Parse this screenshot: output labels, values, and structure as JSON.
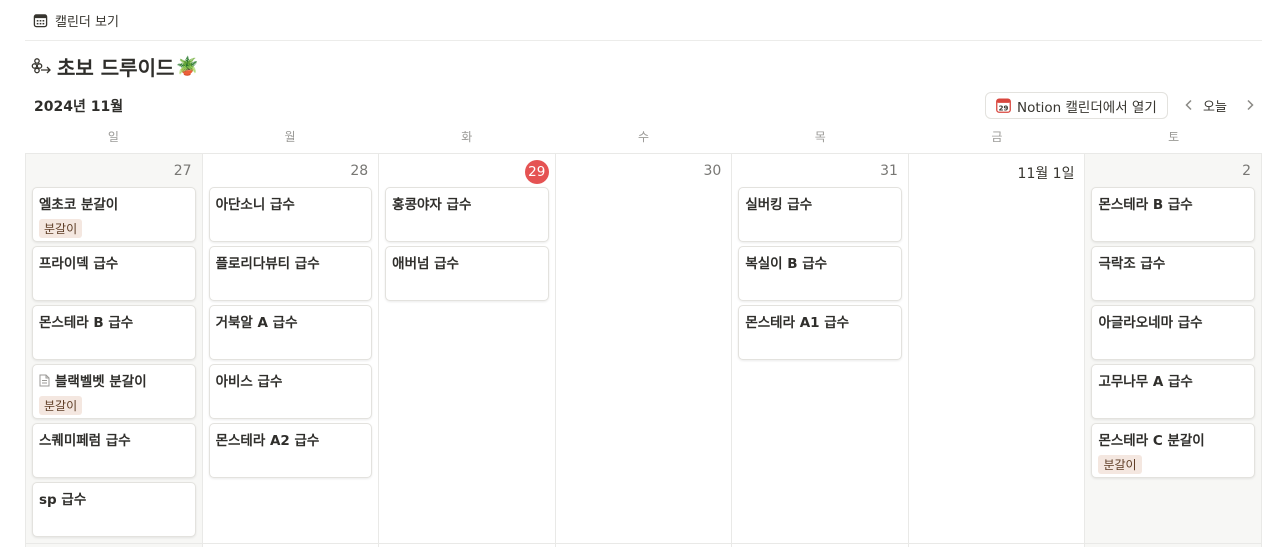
{
  "view": {
    "label": "캘린더 보기",
    "icon": "calendar-icon"
  },
  "page": {
    "title": "초보 드루이드",
    "title_icon": "plant-network-icon",
    "title_emoji": "🪴"
  },
  "month_label": "2024년 11월",
  "toolbar": {
    "open_notion_label": "Notion 캘린더에서 열기",
    "open_notion_icon_day": "29",
    "today_label": "오늘",
    "prev_icon": "chevron-left-icon",
    "next_icon": "chevron-right-icon"
  },
  "weekdays": [
    "일",
    "월",
    "화",
    "수",
    "목",
    "금",
    "토"
  ],
  "tag_color": "#f4e7e0",
  "today_color": "#e55353",
  "days": [
    {
      "date": "27",
      "cards": [
        {
          "title": "엘초코 분갈이",
          "tag": "분갈이"
        },
        {
          "title": "프라이덱 급수"
        },
        {
          "title": "몬스테라 B 급수"
        },
        {
          "title": "블랙벨벳 분갈이",
          "tag": "분갈이",
          "doc_icon": true
        },
        {
          "title": "스퀘미페럼 급수"
        },
        {
          "title": "sp 급수"
        }
      ]
    },
    {
      "date": "28",
      "cards": [
        {
          "title": "아단소니 급수"
        },
        {
          "title": "플로리다뷰티 급수"
        },
        {
          "title": "거북알 A 급수"
        },
        {
          "title": "아비스 급수"
        },
        {
          "title": "몬스테라 A2 급수"
        }
      ]
    },
    {
      "date": "29",
      "cards": [
        {
          "title": "홍콩야자 급수"
        },
        {
          "title": "애버넘 급수"
        }
      ]
    },
    {
      "date": "30",
      "cards": []
    },
    {
      "date": "31",
      "cards": [
        {
          "title": "실버킹 급수"
        },
        {
          "title": "복실이 B 급수"
        },
        {
          "title": "몬스테라 A1 급수"
        }
      ]
    },
    {
      "date": "11월 1일",
      "cards": []
    },
    {
      "date": "2",
      "cards": [
        {
          "title": "몬스테라 B 급수"
        },
        {
          "title": "극락조 급수"
        },
        {
          "title": "아글라오네마 급수"
        },
        {
          "title": "고무나무 A 급수"
        },
        {
          "title": "몬스테라 C 분갈이",
          "tag": "분갈이"
        }
      ]
    }
  ]
}
